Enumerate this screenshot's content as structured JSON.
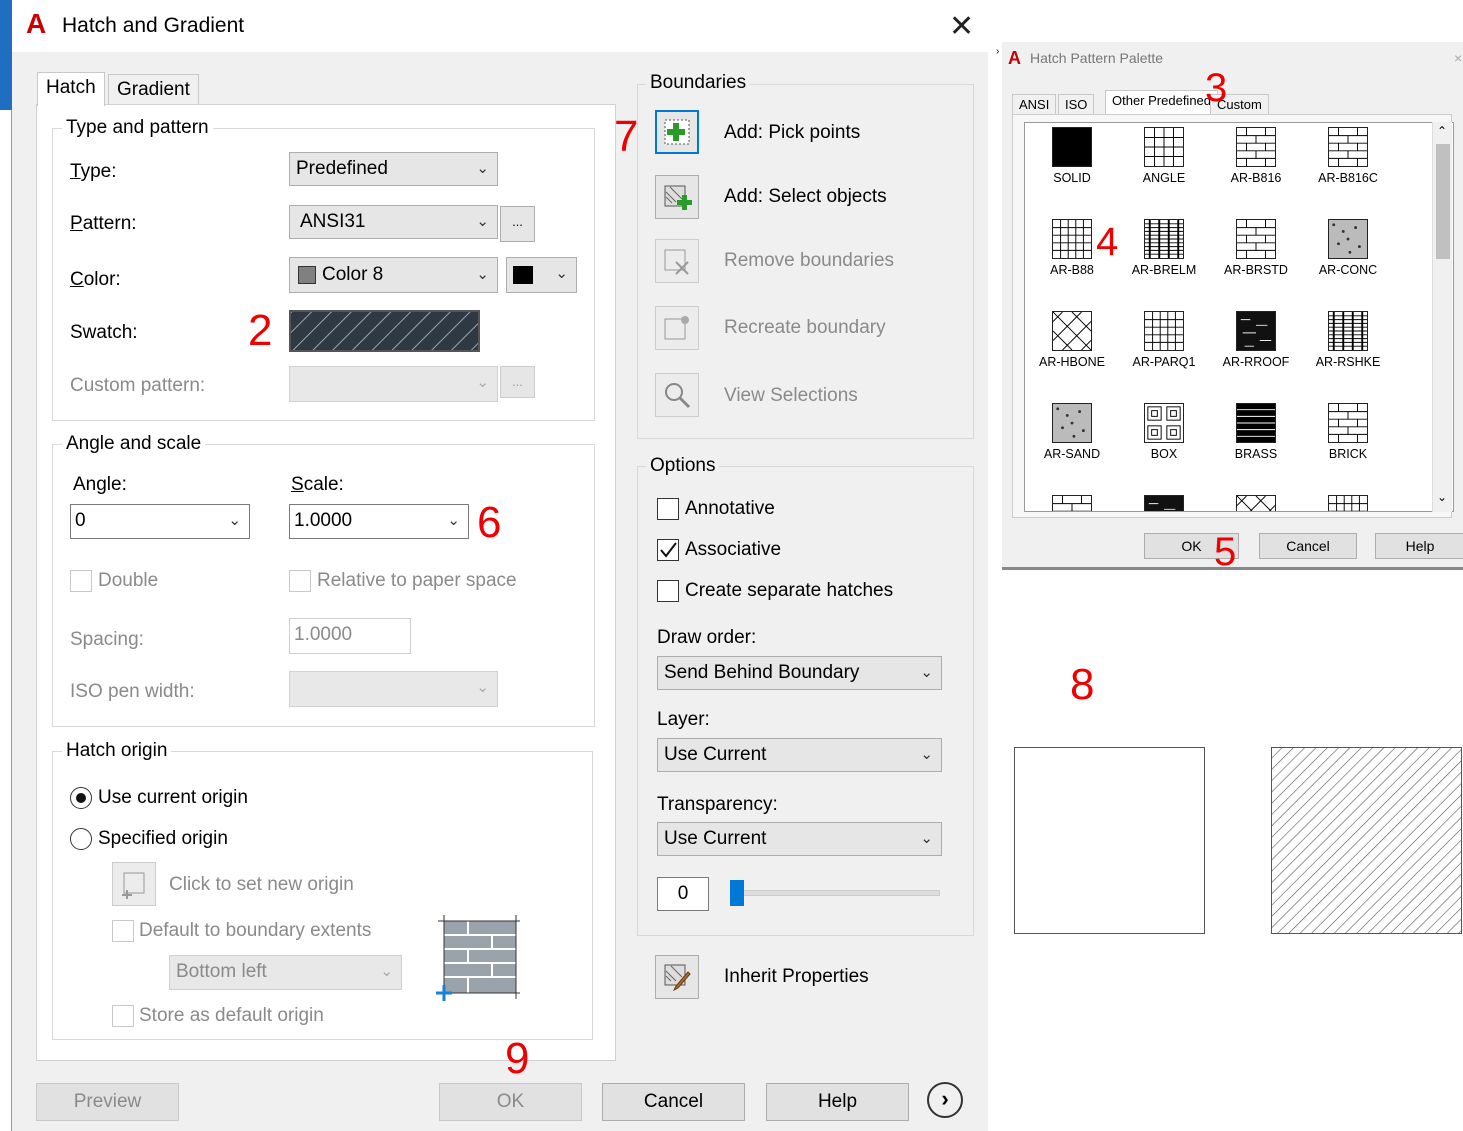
{
  "dialog": {
    "title": "Hatch and Gradient",
    "tabs": [
      "Hatch",
      "Gradient"
    ],
    "type_pattern": {
      "group_title": "Type and pattern",
      "type_label": "Type:",
      "type_value": "Predefined",
      "pattern_label": "Pattern:",
      "pattern_value": "ANSI31",
      "color_label": "Color:",
      "color_value": "Color 8",
      "swatch_label": "Swatch:",
      "custom_label": "Custom pattern:",
      "ellipsis": "..."
    },
    "angle_scale": {
      "group_title": "Angle and scale",
      "angle_label": "Angle:",
      "angle_value": "0",
      "scale_label": "Scale:",
      "scale_value": "1.0000",
      "double_label": "Double",
      "relative_label": "Relative to paper space",
      "spacing_label": "Spacing:",
      "spacing_value": "1.0000",
      "iso_label": "ISO pen width:"
    },
    "hatch_origin": {
      "group_title": "Hatch origin",
      "use_current": "Use current origin",
      "specified": "Specified origin",
      "click_set": "Click to set new origin",
      "default_extents": "Default to boundary extents",
      "bottom_left": "Bottom left",
      "store_default": "Store as default origin"
    },
    "boundaries": {
      "group_title": "Boundaries",
      "add_pick": "Add: Pick points",
      "add_select": "Add: Select objects",
      "remove": "Remove boundaries",
      "recreate": "Recreate boundary",
      "view": "View Selections"
    },
    "options": {
      "group_title": "Options",
      "annotative": "Annotative",
      "associative": "Associative",
      "separate": "Create separate hatches",
      "draw_order_label": "Draw order:",
      "draw_order_value": "Send Behind Boundary",
      "layer_label": "Layer:",
      "layer_value": "Use Current",
      "transparency_label": "Transparency:",
      "transparency_value": "Use Current",
      "transparency_number": "0",
      "transparency_level": 0
    },
    "inherit": "Inherit Properties",
    "buttons": {
      "preview": "Preview",
      "ok": "OK",
      "cancel": "Cancel",
      "help": "Help"
    }
  },
  "palette": {
    "title": "Hatch Pattern Palette",
    "tabs": [
      "ANSI",
      "ISO",
      "Other Predefined",
      "Custom"
    ],
    "patterns": [
      "SOLID",
      "ANGLE",
      "AR-B816",
      "AR-B816C",
      "AR-B88",
      "AR-BRELM",
      "AR-BRSTD",
      "AR-CONC",
      "AR-HBONE",
      "AR-PARQ1",
      "AR-RROOF",
      "AR-RSHKE",
      "AR-SAND",
      "BOX",
      "BRASS",
      "BRICK"
    ],
    "buttons": {
      "ok": "OK",
      "cancel": "Cancel",
      "help": "Help"
    }
  },
  "annotations": {
    "n2": "2",
    "n3": "3",
    "n4": "4",
    "n5": "5",
    "n6": "6",
    "n7": "7",
    "n8": "8",
    "n9": "9"
  },
  "colors": {
    "annotation_red": "#e00000",
    "accent_blue": "#0078d7",
    "logo_red": "#c00000"
  }
}
